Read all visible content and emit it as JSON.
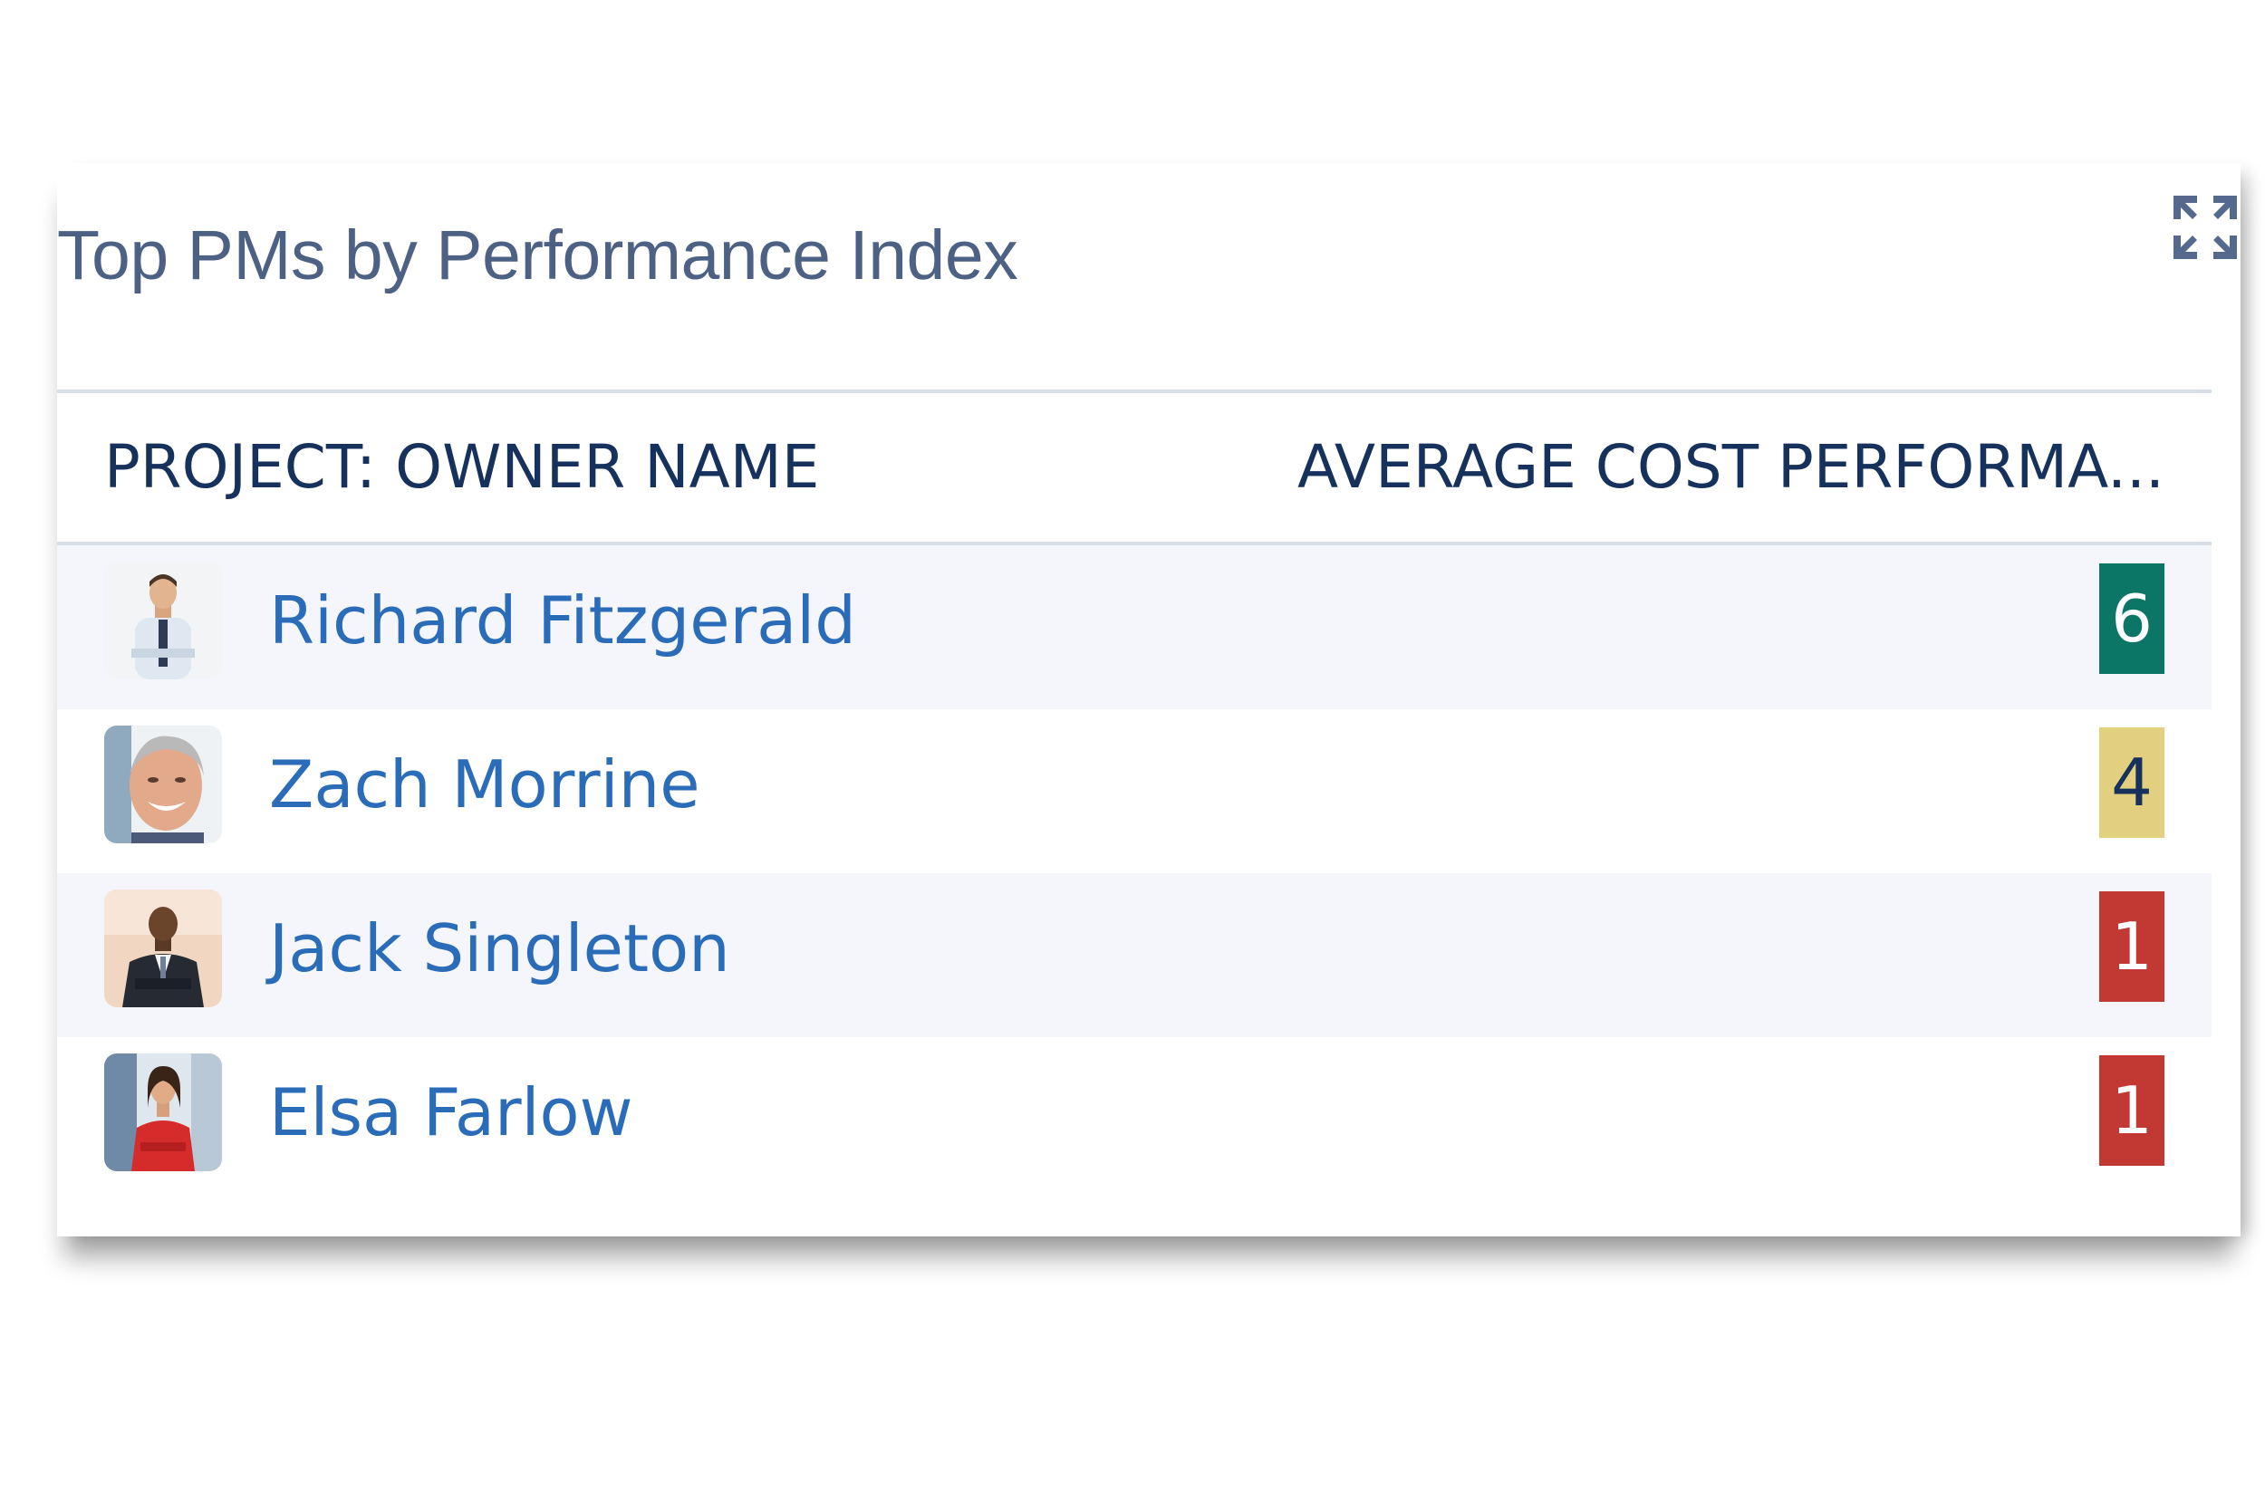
{
  "card": {
    "title": "Top PMs by Performance Index",
    "expand_icon": "expand-arrows-icon"
  },
  "table": {
    "headers": {
      "owner": "PROJECT: OWNER NAME",
      "avg": "AVERAGE COST PERFORMA..."
    },
    "rows": [
      {
        "name": "Richard Fitzgerald",
        "value": "6",
        "badge_color": "#0b7566",
        "text_color": "#ffffff",
        "avatar": "avatar-man-white-shirt"
      },
      {
        "name": "Zach Morrine",
        "value": "4",
        "badge_color": "#e2cf7f",
        "text_color": "#16325c",
        "avatar": "avatar-smiling-gray-hair"
      },
      {
        "name": "Jack Singleton",
        "value": "1",
        "badge_color": "#c23934",
        "text_color": "#ffffff",
        "avatar": "avatar-man-dark-suit"
      },
      {
        "name": "Elsa Farlow",
        "value": "1",
        "badge_color": "#c23934",
        "text_color": "#ffffff",
        "avatar": "avatar-woman-red-top"
      }
    ]
  },
  "colors": {
    "title": "#4d6185",
    "header_text": "#16325c",
    "link": "#2b6cb8",
    "rule": "#d8dde6",
    "row_alt": "#f4f6fb"
  }
}
